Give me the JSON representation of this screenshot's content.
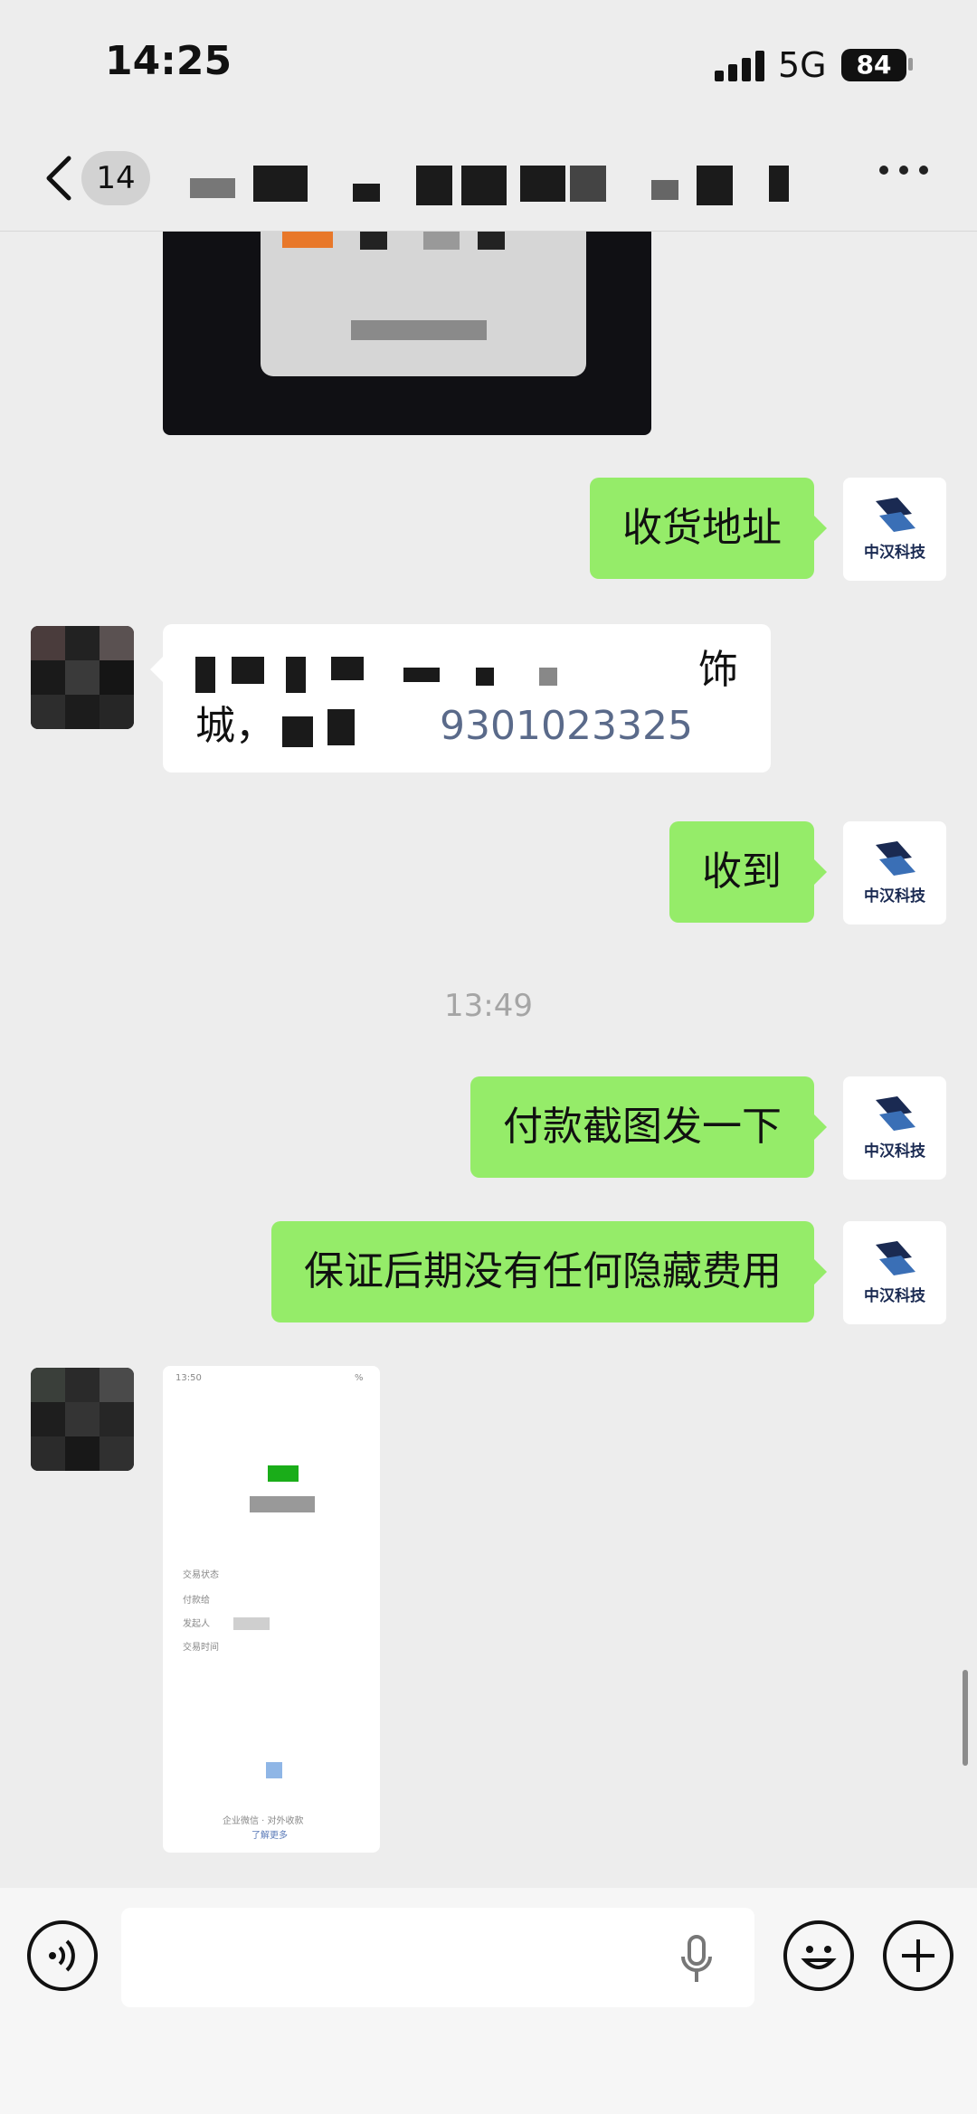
{
  "status_bar": {
    "time": "14:25",
    "network": "5G",
    "battery": "84"
  },
  "nav": {
    "unread_count": "14"
  },
  "messages": {
    "m1": "收货地址",
    "m2_line1": "饰",
    "m2_line2": "城，",
    "m2_phone": "9301023325",
    "m3": "收到",
    "divider_time": "13:49",
    "m4": "付款截图发一下",
    "m5": "保证后期没有任何隐藏费用"
  },
  "self_avatar": {
    "brand": "中汉科技"
  },
  "payment_screenshot": {
    "time": "13:50",
    "battery": "%",
    "labels": [
      "交易状态",
      "付款给",
      "发起人",
      "交易时间"
    ],
    "footer": "企业微信 · 对外收款",
    "more_link": "了解更多"
  },
  "colors": {
    "outgoing": "#95ec69",
    "incoming": "#ffffff",
    "background": "#ededed"
  }
}
